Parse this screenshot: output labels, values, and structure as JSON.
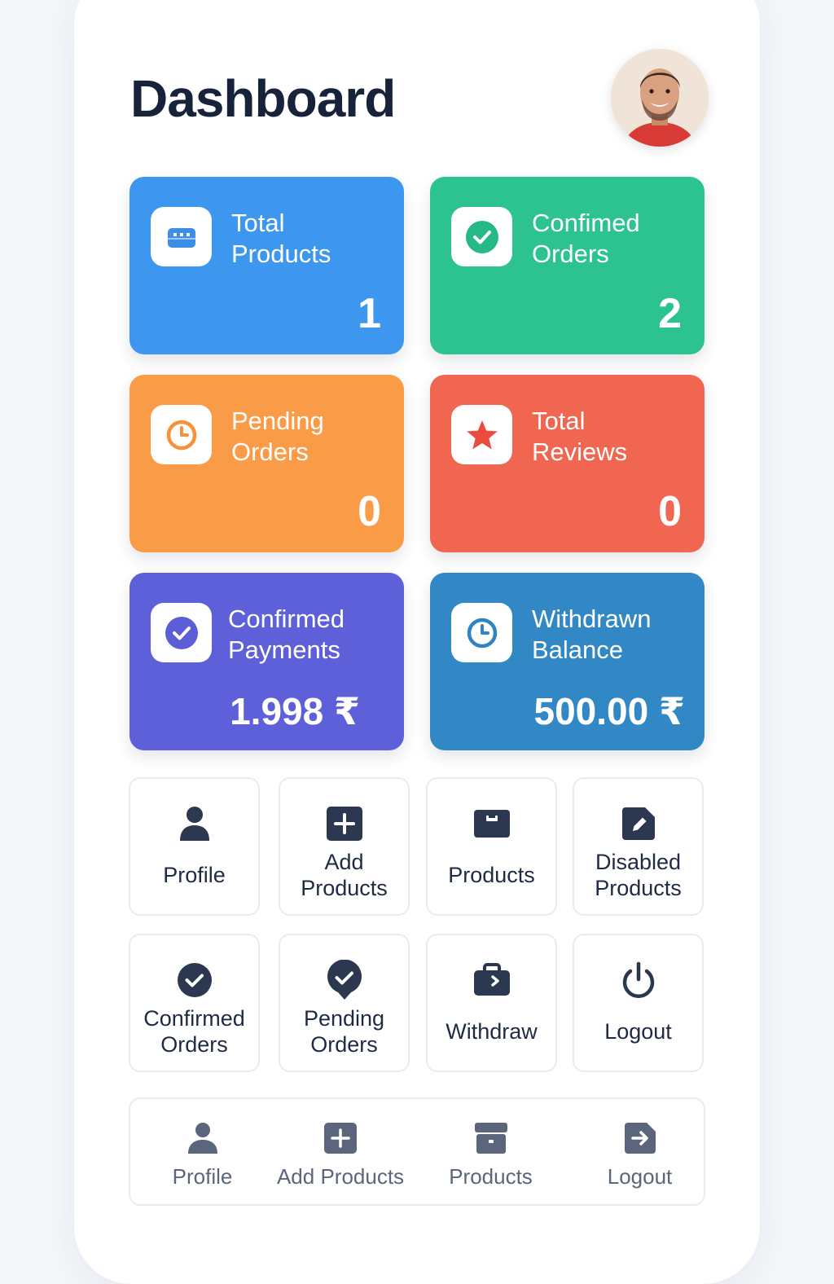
{
  "header": {
    "title": "Dashboard",
    "avatar_icon": "user-photo"
  },
  "stats": [
    {
      "label": "Total\nProducts",
      "value": "1",
      "icon": "box-icon",
      "color": "#3d97ee",
      "icon_color": "#3d8ee6"
    },
    {
      "label": "Confimed\nOrders",
      "value": "2",
      "icon": "check-circle-icon",
      "color": "#2cc391",
      "icon_color": "#24b985"
    },
    {
      "label": "Pending\nOrders",
      "value": "0",
      "icon": "clock-icon",
      "color": "#fa9b47",
      "icon_color": "#f7913a"
    },
    {
      "label": "Total\nReviews",
      "value": "0",
      "icon": "star-icon",
      "color": "#f06650",
      "icon_color": "#ec4c3e"
    },
    {
      "label": "Confirmed\nPayments",
      "value": "1.998 ₹",
      "icon": "check-circle-icon",
      "color": "#5d60d8",
      "icon_color": "#5b5ed6"
    },
    {
      "label": "Withdrawn\nBalance",
      "value": "500.00 ₹",
      "icon": "clock-icon",
      "color": "#3188c4",
      "icon_color": "#2f84c2"
    }
  ],
  "menu": [
    {
      "label": "Profile",
      "icon": "user-icon"
    },
    {
      "label": "Add\nProducts",
      "icon": "plus-square-icon"
    },
    {
      "label": "Products",
      "icon": "box-icon"
    },
    {
      "label": "Disabled\nProducts",
      "icon": "edit-icon"
    },
    {
      "label": "Confirmed\nOrders",
      "icon": "check-circle-icon"
    },
    {
      "label": "Pending\nOrders",
      "icon": "check-badge-icon"
    },
    {
      "label": "Withdraw",
      "icon": "wallet-icon"
    },
    {
      "label": "Logout",
      "icon": "power-icon"
    }
  ],
  "bottom_nav": [
    {
      "label": "Profile",
      "icon": "user-icon"
    },
    {
      "label": "Add Products",
      "icon": "plus-square-icon"
    },
    {
      "label": "Products",
      "icon": "archive-icon"
    },
    {
      "label": "Logout",
      "icon": "logout-icon"
    }
  ]
}
